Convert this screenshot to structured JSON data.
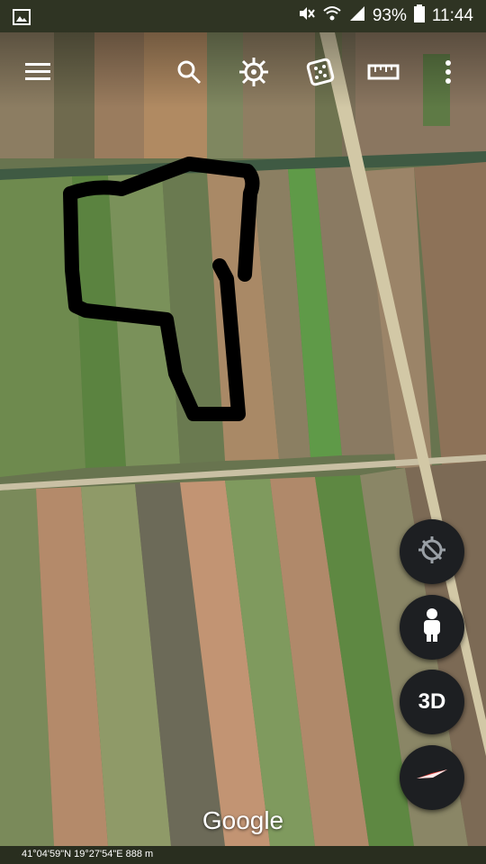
{
  "status_bar": {
    "battery_percent": "93%",
    "time": "11:44",
    "battery_level": 0.93
  },
  "toolbar": {
    "items": [
      "menu-icon",
      "search-icon",
      "voyager-icon",
      "dice-icon",
      "ruler-icon",
      "more-icon"
    ]
  },
  "fab": {
    "items": [
      "reset-orientation-icon",
      "pegman-icon",
      "3d-toggle",
      "compass-icon"
    ],
    "three_d_label": "3D"
  },
  "map": {
    "logo": "Google",
    "coordinates": "41°04'59\"N 19°27'54\"E 888 m",
    "colors": {
      "drawn_outline": "#000000",
      "road": "#cfc6a8",
      "field_green": "#5e8a3f",
      "field_brown": "#a78767"
    }
  }
}
